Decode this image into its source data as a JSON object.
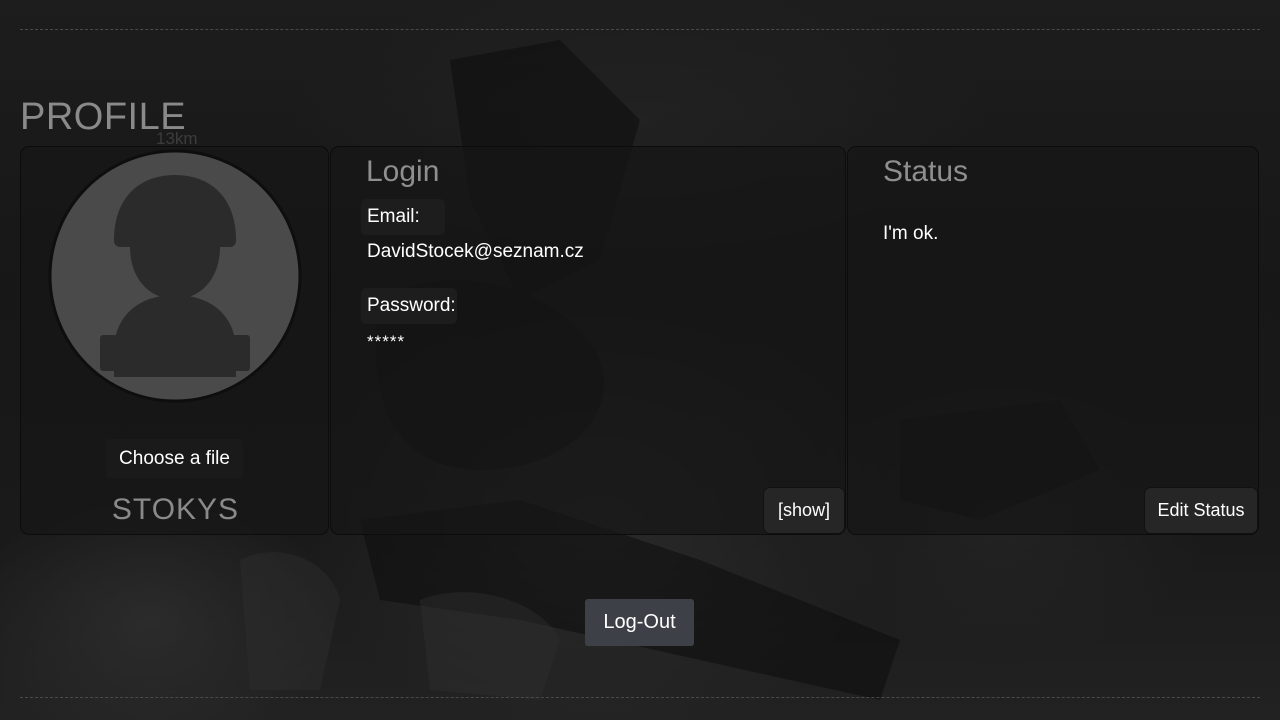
{
  "page": {
    "heading": "PROFILE",
    "background_ghost_text": "13km"
  },
  "avatar_card": {
    "avatar_icon": "soldier-avatar-icon",
    "choose_file_label": "Choose a file",
    "username": "STOKYS"
  },
  "login_card": {
    "title": "Login",
    "email_label": "Email:",
    "email_value": "DavidStocek@seznam.cz",
    "password_label": "Password:",
    "password_value": "*****",
    "show_label": "[show]"
  },
  "status_card": {
    "title": "Status",
    "status_text": "I'm ok.",
    "edit_label": "Edit Status"
  },
  "footer": {
    "logout_label": "Log-Out"
  },
  "colors": {
    "heading": "#8a8a8a",
    "card_background": "#161616",
    "button_background": "#262626",
    "logout_background": "#3d4147",
    "avatar_circle": "#4a4a4a",
    "avatar_silhouette": "#2b2b2b"
  }
}
